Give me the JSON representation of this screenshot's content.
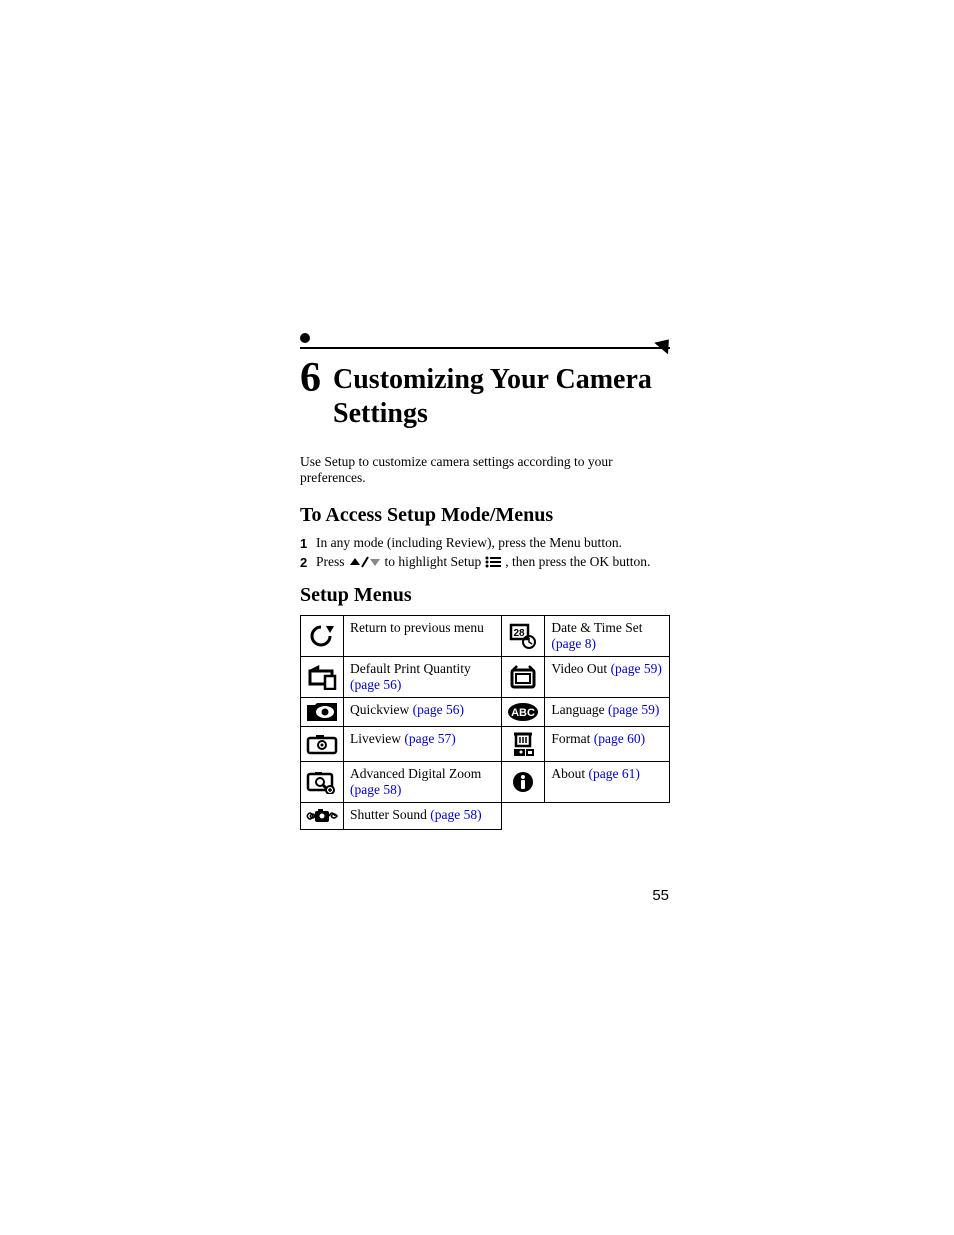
{
  "chapter": {
    "number": "6",
    "title": "Customizing Your Camera Settings"
  },
  "intro": "Use Setup to customize camera settings according to your preferences.",
  "section_access": "To Access Setup Mode/Menus",
  "steps": {
    "s1": {
      "num": "1",
      "text": "In any mode (including Review), press the Menu button."
    },
    "s2": {
      "num": "2",
      "a": "Press ",
      "b": " to highlight Setup",
      "c": " , then press the OK button."
    }
  },
  "section_menus": "Setup Menus",
  "rows": {
    "l1": {
      "text": "Return to previous menu"
    },
    "l2": {
      "text": "Default Print Quantity ",
      "link": "(page 56)"
    },
    "l3": {
      "text": "Quickview ",
      "link": "(page 56)"
    },
    "l4": {
      "text": "Liveview ",
      "link": "(page 57)"
    },
    "l5": {
      "text": "Advanced Digital Zoom ",
      "link": "(page 58)"
    },
    "l6": {
      "text": "Shutter Sound ",
      "link": "(page 58)"
    },
    "r1": {
      "text": "Date & Time Set ",
      "link": "(page 8)"
    },
    "r2": {
      "text": "Video Out ",
      "link": "(page 59)"
    },
    "r3": {
      "text": "Language ",
      "link": "(page 59)"
    },
    "r4": {
      "text": "Format ",
      "link": "(page 60)"
    },
    "r5": {
      "text": "About ",
      "link": "(page 61)"
    }
  },
  "page_number": "55"
}
